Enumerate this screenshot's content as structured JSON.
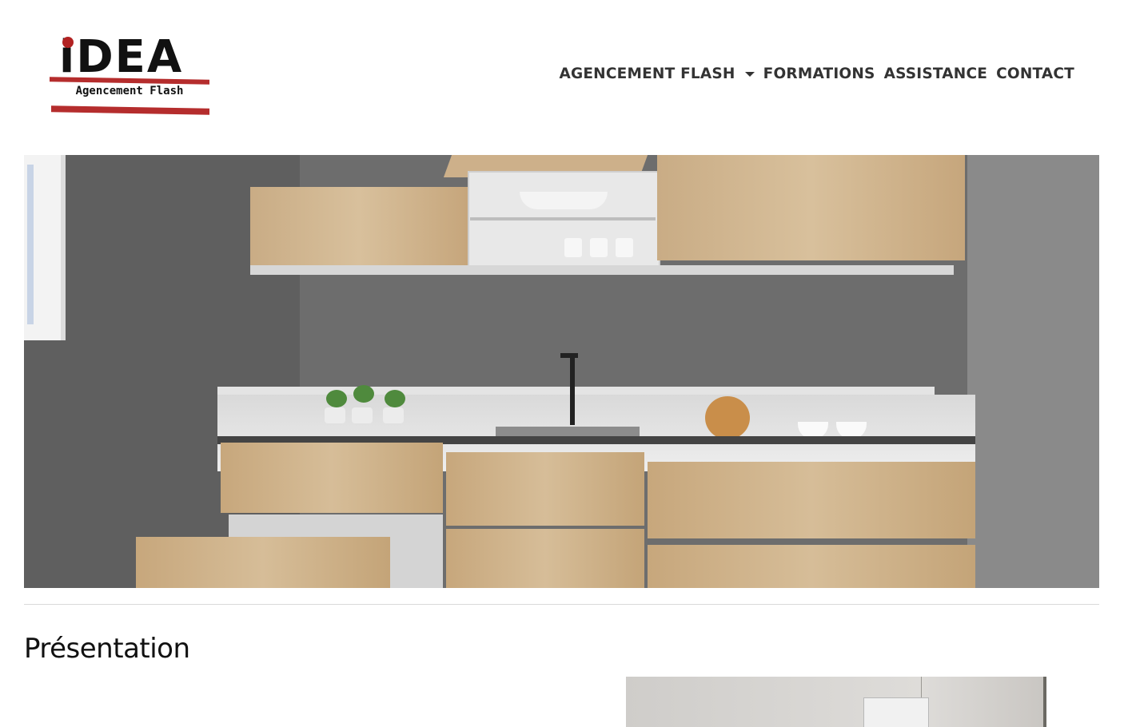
{
  "brand": {
    "logo_word": "iDEA",
    "logo_tagline": "Agencement Flash",
    "accent": "#b52d2d"
  },
  "nav": {
    "items": [
      {
        "label": "AGENCEMENT FLASH",
        "has_dropdown": true
      },
      {
        "label": "FORMATIONS"
      },
      {
        "label": "ASSISTANCE"
      },
      {
        "label": "CONTACT"
      }
    ]
  },
  "main": {
    "section_title": "Présentation"
  }
}
